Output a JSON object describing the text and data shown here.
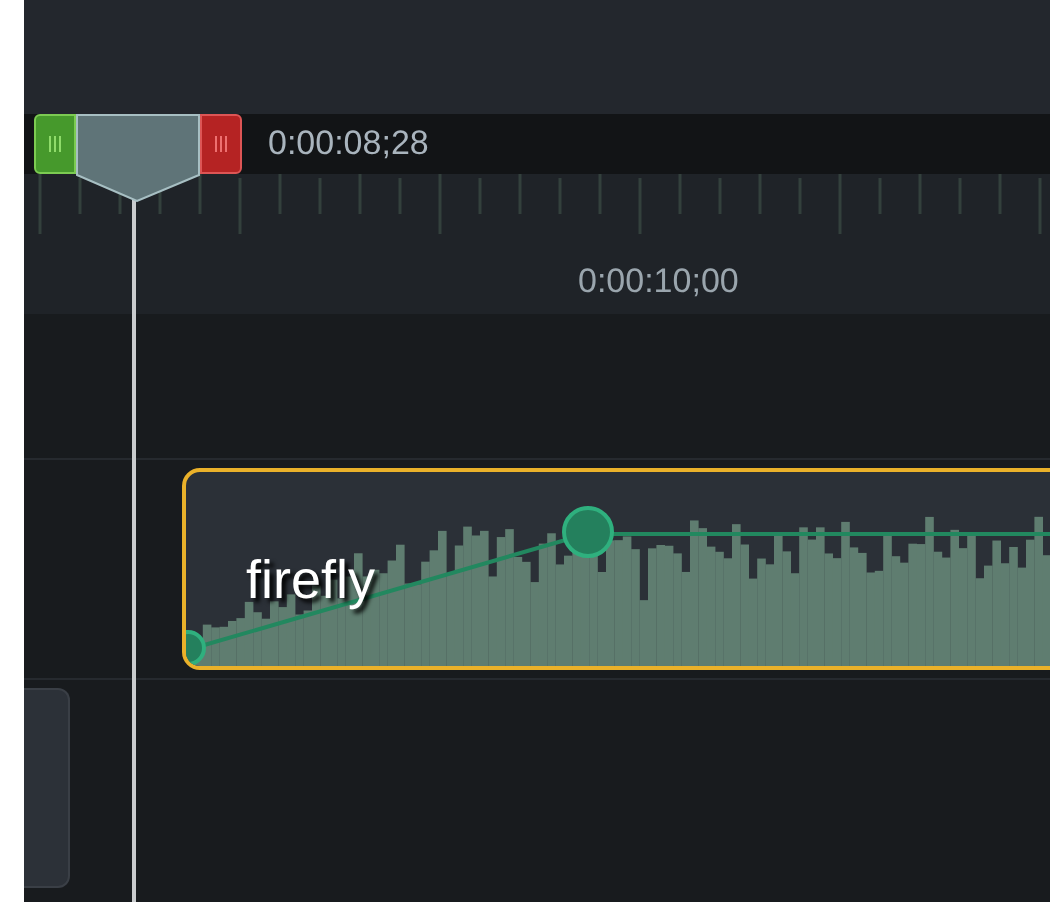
{
  "timeline": {
    "playhead_time": "0:00:08;28",
    "ruler_label": "0:00:10;00"
  },
  "clip": {
    "name": "firefly",
    "selected": true
  }
}
